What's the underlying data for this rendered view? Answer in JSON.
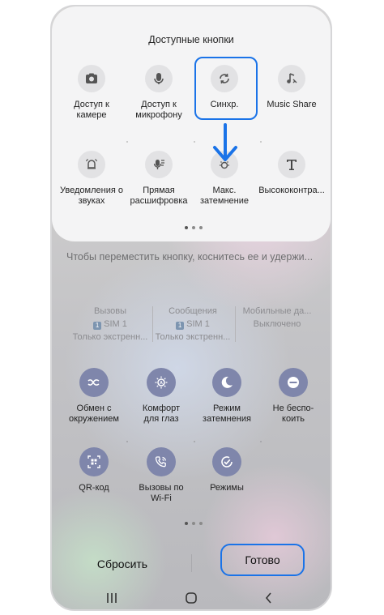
{
  "panel": {
    "title": "Доступные кнопки",
    "buttons": [
      {
        "label": "Доступ к\nкамере",
        "icon": "camera-icon"
      },
      {
        "label": "Доступ к\nмикрофону",
        "icon": "microphone-icon"
      },
      {
        "label": "Синхр.",
        "icon": "sync-icon"
      },
      {
        "label": "Music Share",
        "icon": "music-share-icon"
      },
      {
        "label": "Уведомления о\nзвуках",
        "icon": "sound-notification-icon"
      },
      {
        "label": "Прямая\nрасшифровка",
        "icon": "live-transcribe-icon"
      },
      {
        "label": "Макс.\nзатемнение",
        "icon": "extra-dim-icon"
      },
      {
        "label": "Высококонтра...",
        "icon": "high-contrast-text-icon"
      }
    ]
  },
  "hint": "Чтобы переместить кнопку, коснитесь ее и удержи...",
  "sim_status": [
    {
      "title": "Вызовы",
      "sim": "SIM 1",
      "status": "Только экстренн..."
    },
    {
      "title": "Сообщения",
      "sim": "SIM 1",
      "status": "Только экстренн..."
    },
    {
      "title": "Мобильные да...",
      "sim": "",
      "status": "Выключено"
    }
  ],
  "sim_badge": "1",
  "quick_settings": [
    {
      "label": "Обмен с\nокружением",
      "icon": "nearby-share-icon"
    },
    {
      "label": "Комфорт\nдля глаз",
      "icon": "eye-comfort-icon"
    },
    {
      "label": "Режим\nзатемнения",
      "icon": "dark-mode-icon"
    },
    {
      "label": "Не беспо-\nкоить",
      "icon": "do-not-disturb-icon"
    },
    {
      "label": "QR-код",
      "icon": "qr-code-icon"
    },
    {
      "label": "Вызовы по\nWi-Fi",
      "icon": "wifi-calling-icon"
    },
    {
      "label": "Режимы",
      "icon": "modes-icon"
    }
  ],
  "actions": {
    "reset": "Сбросить",
    "done": "Готово"
  },
  "colors": {
    "highlight": "#1a73e8",
    "qs_circle": "#7f86ab",
    "panel": "#f4f4f5"
  }
}
